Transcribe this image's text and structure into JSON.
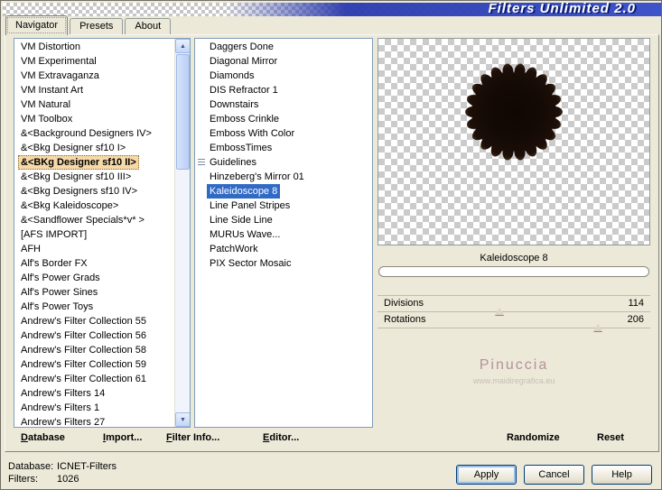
{
  "window": {
    "title": "Filters Unlimited 2.0"
  },
  "tabs": {
    "items": [
      {
        "label": "Navigator",
        "active": true
      },
      {
        "label": "Presets",
        "active": false
      },
      {
        "label": "About",
        "active": false
      }
    ]
  },
  "categories": {
    "selected_index": 8,
    "items": [
      "VM Distortion",
      "VM Experimental",
      "VM Extravaganza",
      "VM Instant Art",
      "VM Natural",
      "VM Toolbox",
      "&<Background Designers IV>",
      "&<Bkg Designer sf10 I>",
      "&<BKg Designer sf10 II>",
      "&<Bkg Designer sf10 III>",
      "&<Bkg Designers sf10 IV>",
      "&<Bkg Kaleidoscope>",
      "&<Sandflower Specials*v* >",
      "[AFS IMPORT]",
      "AFH",
      "Alf's Border FX",
      "Alf's Power Grads",
      "Alf's Power Sines",
      "Alf's Power Toys",
      "Andrew's Filter Collection 55",
      "Andrew's Filter Collection 56",
      "Andrew's Filter Collection 58",
      "Andrew's Filter Collection 59",
      "Andrew's Filter Collection 61",
      "Andrew's Filters 14",
      "Andrew's Filters 1",
      "Andrew's Filters 27"
    ]
  },
  "filters": {
    "selected_index": 10,
    "items": [
      {
        "label": "Daggers Done"
      },
      {
        "label": "Diagonal Mirror"
      },
      {
        "label": "Diamonds"
      },
      {
        "label": "DIS Refractor 1"
      },
      {
        "label": "Downstairs"
      },
      {
        "label": "Emboss Crinkle"
      },
      {
        "label": "Emboss With Color"
      },
      {
        "label": "EmbossTimes"
      },
      {
        "label": "Guidelines",
        "icon": "list-icon"
      },
      {
        "label": "Hinzeberg's Mirror 01"
      },
      {
        "label": "Kaleidoscope 8"
      },
      {
        "label": "Line Panel Stripes"
      },
      {
        "label": "Line Side Line"
      },
      {
        "label": "MURUs Wave..."
      },
      {
        "label": "PatchWork"
      },
      {
        "label": "PIX Sector Mosaic"
      }
    ]
  },
  "preview": {
    "selected_filter": "Kaleidoscope 8",
    "params": [
      {
        "name": "Divisions",
        "value": 114,
        "max": 255
      },
      {
        "name": "Rotations",
        "value": 206,
        "max": 255
      }
    ],
    "watermark_line1": "Pinuccia",
    "watermark_line2": "www.maidiregrafica.eu"
  },
  "toolbar": {
    "left": [
      {
        "label": "Database"
      },
      {
        "label": "Import..."
      },
      {
        "label": "Filter Info..."
      },
      {
        "label": "Editor..."
      }
    ],
    "right": [
      {
        "label": "Randomize"
      },
      {
        "label": "Reset"
      }
    ]
  },
  "status": {
    "line1_label": "Database:",
    "line1_value": "ICNET-Filters",
    "line2_label": "Filters:",
    "line2_value": "1026"
  },
  "action_buttons": [
    {
      "label": "Apply",
      "default": true
    },
    {
      "label": "Cancel",
      "default": false
    },
    {
      "label": "Help",
      "default": false
    }
  ],
  "colors": {
    "dialog_bg": "#ece9d8",
    "selection_blue": "#316ac5",
    "category_highlight": "#f6d9a8",
    "banner_blue": "#2c3cae",
    "flower_dark": "#170c07"
  }
}
